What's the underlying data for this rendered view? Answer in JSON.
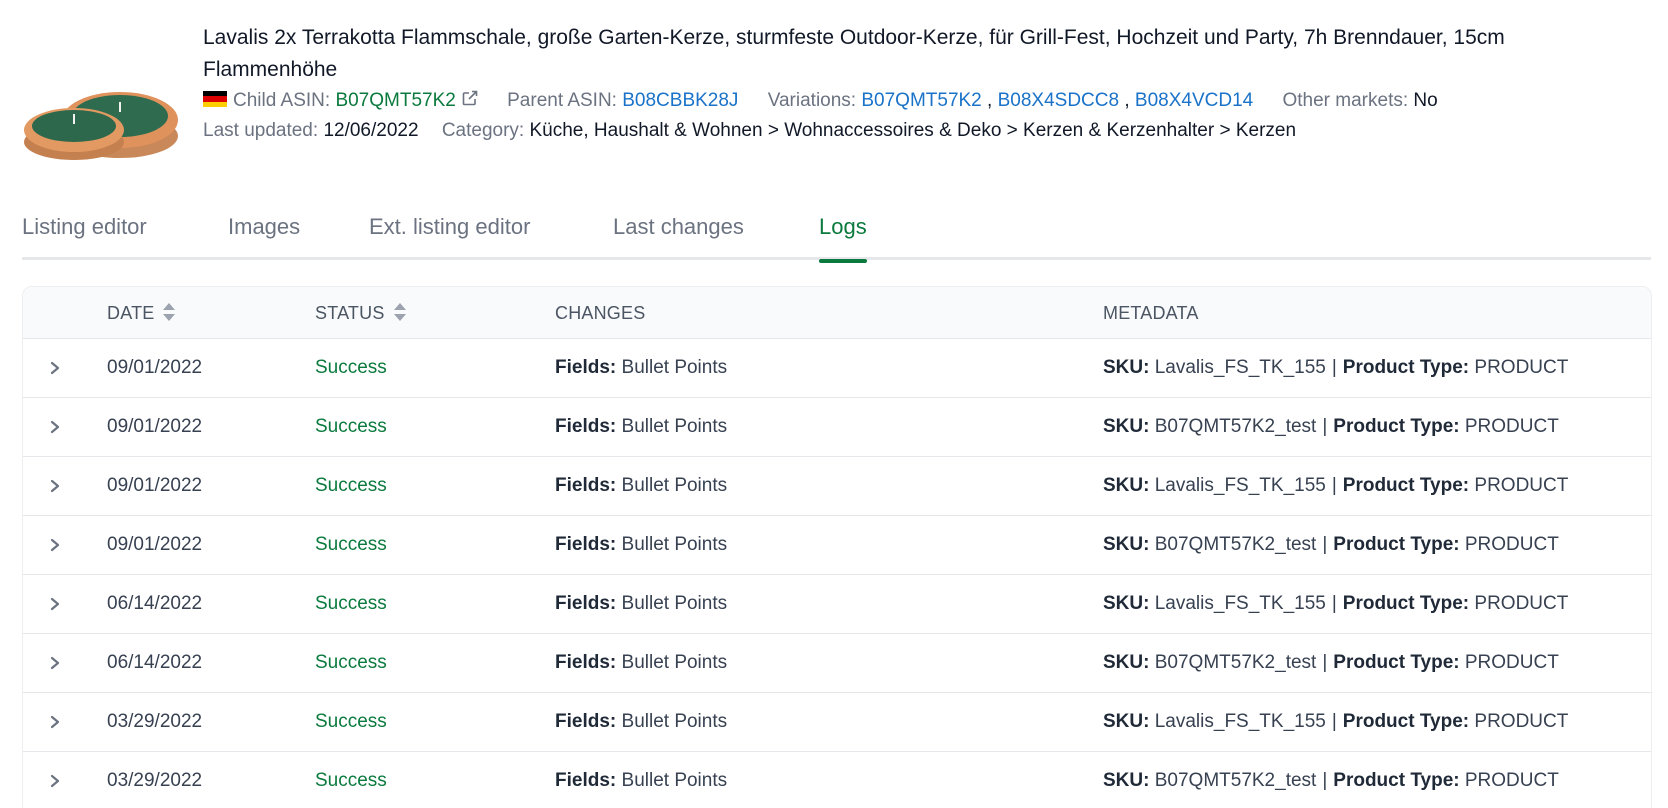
{
  "product": {
    "title": "Lavalis 2x Terrakotta Flammschale, große Garten-Kerze, sturmfeste Outdoor-Kerze, für Grill-Fest, Hochzeit und Party, 7h Brenndauer, 15cm Flammenhöhe",
    "child_asin_label": "Child ASIN:",
    "child_asin": "B07QMT57K2",
    "parent_asin_label": "Parent ASIN:",
    "parent_asin": "B08CBBK28J",
    "variations_label": "Variations:",
    "variations": [
      "B07QMT57K2",
      "B08X4SDCC8",
      "B08X4VCD14"
    ],
    "variation_sep": ",",
    "other_markets_label": "Other markets:",
    "other_markets": "No",
    "last_updated_label": "Last updated:",
    "last_updated": "12/06/2022",
    "category_label": "Category:",
    "category": "Küche, Haushalt & Wohnen > Wohnaccessoires & Deko > Kerzen & Kerzenhalter > Kerzen"
  },
  "tabs": [
    {
      "label": "Listing editor",
      "active": false
    },
    {
      "label": "Images",
      "active": false
    },
    {
      "label": "Ext. listing editor",
      "active": false
    },
    {
      "label": "Last changes",
      "active": false
    },
    {
      "label": "Logs",
      "active": true
    }
  ],
  "table": {
    "columns": [
      "DATE",
      "STATUS",
      "CHANGES",
      "METADATA"
    ],
    "fields_label": "Fields:",
    "sku_label": "SKU:",
    "product_type_label": "Product Type:",
    "separator": "|",
    "rows": [
      {
        "date": "09/01/2022",
        "status": "Success",
        "fields": "Bullet Points",
        "sku": "Lavalis_FS_TK_155",
        "product_type": "PRODUCT"
      },
      {
        "date": "09/01/2022",
        "status": "Success",
        "fields": "Bullet Points",
        "sku": "B07QMT57K2_test",
        "product_type": "PRODUCT"
      },
      {
        "date": "09/01/2022",
        "status": "Success",
        "fields": "Bullet Points",
        "sku": "Lavalis_FS_TK_155",
        "product_type": "PRODUCT"
      },
      {
        "date": "09/01/2022",
        "status": "Success",
        "fields": "Bullet Points",
        "sku": "B07QMT57K2_test",
        "product_type": "PRODUCT"
      },
      {
        "date": "06/14/2022",
        "status": "Success",
        "fields": "Bullet Points",
        "sku": "Lavalis_FS_TK_155",
        "product_type": "PRODUCT"
      },
      {
        "date": "06/14/2022",
        "status": "Success",
        "fields": "Bullet Points",
        "sku": "B07QMT57K2_test",
        "product_type": "PRODUCT"
      },
      {
        "date": "03/29/2022",
        "status": "Success",
        "fields": "Bullet Points",
        "sku": "Lavalis_FS_TK_155",
        "product_type": "PRODUCT"
      },
      {
        "date": "03/29/2022",
        "status": "Success",
        "fields": "Bullet Points",
        "sku": "B07QMT57K2_test",
        "product_type": "PRODUCT"
      }
    ]
  },
  "icons": {
    "flag": "germany-flag-icon",
    "external": "external-link-icon",
    "sort": "sort-icon",
    "expand": "chevron-right-icon"
  },
  "colors": {
    "accent_green": "#0b7a3e",
    "link_blue": "#1a73c8"
  }
}
